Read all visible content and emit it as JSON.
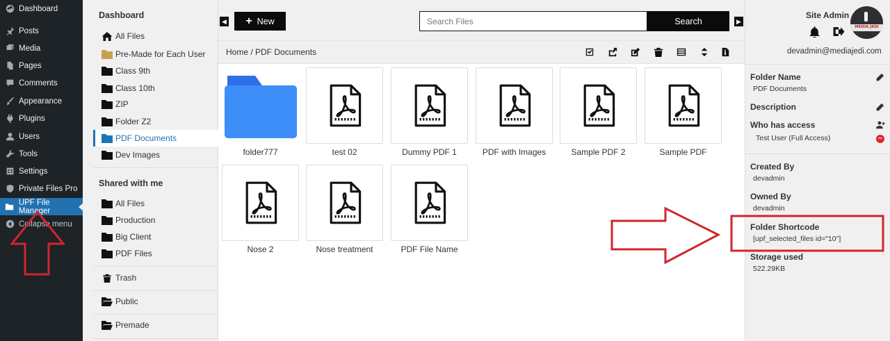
{
  "wp_menu": [
    {
      "label": "Dashboard",
      "icon": "dashboard-icon"
    },
    {
      "label": "Posts",
      "icon": "pin-icon"
    },
    {
      "label": "Media",
      "icon": "media-icon"
    },
    {
      "label": "Pages",
      "icon": "pages-icon"
    },
    {
      "label": "Comments",
      "icon": "comment-icon"
    },
    {
      "label": "Appearance",
      "icon": "brush-icon"
    },
    {
      "label": "Plugins",
      "icon": "plug-icon"
    },
    {
      "label": "Users",
      "icon": "user-icon"
    },
    {
      "label": "Tools",
      "icon": "wrench-icon"
    },
    {
      "label": "Settings",
      "icon": "settings-icon"
    },
    {
      "label": "Private Files Pro",
      "icon": "shield-icon"
    },
    {
      "label": "UPF File Manager",
      "icon": "folder-icon"
    },
    {
      "label": "Collapse menu",
      "icon": "collapse-icon"
    }
  ],
  "tree": {
    "heading": "Dashboard",
    "items": [
      {
        "label": "All Files",
        "icon": "home-icon"
      },
      {
        "label": "Pre-Made for Each User",
        "icon": "folder-icon"
      },
      {
        "label": "Class 9th",
        "icon": "folder-icon"
      },
      {
        "label": "Class 10th",
        "icon": "folder-icon"
      },
      {
        "label": "ZIP",
        "icon": "folder-icon"
      },
      {
        "label": "Folder Z2",
        "icon": "folder-icon"
      },
      {
        "label": "PDF Documents",
        "icon": "folder-icon"
      },
      {
        "label": "Dev Images",
        "icon": "folder-icon"
      }
    ],
    "shared_heading": "Shared with me",
    "shared_items": [
      {
        "label": "All Files"
      },
      {
        "label": "Production"
      },
      {
        "label": "Big Client"
      },
      {
        "label": "PDF Files"
      }
    ],
    "trash": "Trash",
    "public": "Public",
    "premade": "Premade"
  },
  "toolbar": {
    "new_label": "New",
    "search_placeholder": "Search Files",
    "search_button": "Search"
  },
  "breadcrumb": "Home / PDF Documents",
  "tools": [
    "check-square-icon",
    "share-icon",
    "edit-icon",
    "trash-icon",
    "list-icon",
    "sort-icon",
    "file-info-icon"
  ],
  "files": [
    {
      "name": "folder777",
      "type": "folder"
    },
    {
      "name": "test 02",
      "type": "pdf"
    },
    {
      "name": "Dummy PDF 1",
      "type": "pdf"
    },
    {
      "name": "PDF with Images",
      "type": "pdf"
    },
    {
      "name": "Sample PDF 2",
      "type": "pdf"
    },
    {
      "name": "Sample PDF",
      "type": "pdf"
    },
    {
      "name": "Nose 2",
      "type": "pdf"
    },
    {
      "name": "Nose treatment",
      "type": "pdf"
    },
    {
      "name": "PDF File Name",
      "type": "pdf"
    }
  ],
  "panel": {
    "user_name": "Site Admin",
    "email": "devadmin@mediajedi.com",
    "avatar_text": "MEDIA JEDI",
    "folder_name_label": "Folder Name",
    "folder_name_value": "PDF Documents",
    "description_label": "Description",
    "access_label": "Who has access",
    "access_value": "Test User (Full Access)",
    "created_by_label": "Created By",
    "created_by_value": "devadmin",
    "owned_by_label": "Owned By",
    "owned_by_value": "devadmin",
    "shortcode_label": "Folder Shortcode",
    "shortcode_value": "[upf_selected_files id=\"10\"]",
    "storage_label": "Storage used",
    "storage_value": "522.29KB"
  },
  "colors": {
    "wp_sidebar": "#1d2327",
    "active_blue": "#2271b1",
    "folder_blue": "#3d8ef8",
    "annotation_red": "#d0252d",
    "premade_folder": "#c8a04c"
  }
}
